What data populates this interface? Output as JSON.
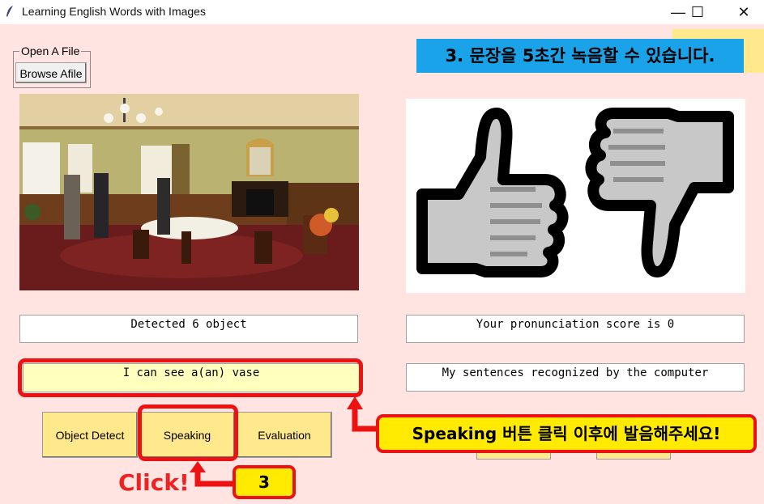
{
  "window": {
    "title": "Learning English Words with Images",
    "minimize_glyph": "—",
    "maximize_glyph": "☐",
    "close_glyph": "✕"
  },
  "file_group": {
    "label": "Open A File",
    "browse_label": "Browse Afile"
  },
  "fields": {
    "detected": "Detected 6 object",
    "sentence": "I can see a(an) vase",
    "score": "Your pronunciation score is 0",
    "recognized": "My sentences recognized by the computer"
  },
  "buttons": {
    "object_detect": "Object Detect",
    "speaking": "Speaking",
    "evaluation": "Evaluation"
  },
  "annotations": {
    "banner": "3. 문장을 5초간 녹음할 수 있습니다.",
    "callout": "Speaking 버튼 클릭 이후에 발음해주세요!",
    "click": "Click!",
    "step": "3"
  },
  "icons": [
    "feather-icon",
    "thumbs-up-icon",
    "thumbs-down-icon"
  ],
  "colors": {
    "background": "#ffe4e1",
    "button": "#ffe98c",
    "highlight_red": "#ee1111",
    "banner_blue": "#1aa3e8",
    "callout_yellow": "#ffea00"
  }
}
